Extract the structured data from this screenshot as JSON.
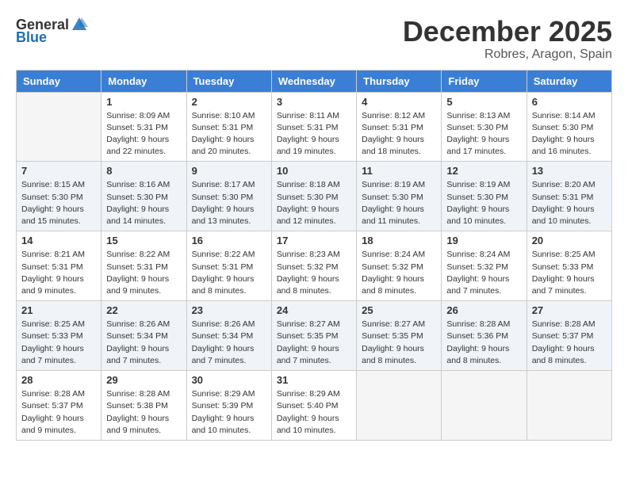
{
  "logo": {
    "general": "General",
    "blue": "Blue"
  },
  "title": "December 2025",
  "location": "Robres, Aragon, Spain",
  "days_of_week": [
    "Sunday",
    "Monday",
    "Tuesday",
    "Wednesday",
    "Thursday",
    "Friday",
    "Saturday"
  ],
  "weeks": [
    [
      {
        "day": "",
        "sunrise": "",
        "sunset": "",
        "daylight": ""
      },
      {
        "day": "1",
        "sunrise": "Sunrise: 8:09 AM",
        "sunset": "Sunset: 5:31 PM",
        "daylight": "Daylight: 9 hours and 22 minutes."
      },
      {
        "day": "2",
        "sunrise": "Sunrise: 8:10 AM",
        "sunset": "Sunset: 5:31 PM",
        "daylight": "Daylight: 9 hours and 20 minutes."
      },
      {
        "day": "3",
        "sunrise": "Sunrise: 8:11 AM",
        "sunset": "Sunset: 5:31 PM",
        "daylight": "Daylight: 9 hours and 19 minutes."
      },
      {
        "day": "4",
        "sunrise": "Sunrise: 8:12 AM",
        "sunset": "Sunset: 5:31 PM",
        "daylight": "Daylight: 9 hours and 18 minutes."
      },
      {
        "day": "5",
        "sunrise": "Sunrise: 8:13 AM",
        "sunset": "Sunset: 5:30 PM",
        "daylight": "Daylight: 9 hours and 17 minutes."
      },
      {
        "day": "6",
        "sunrise": "Sunrise: 8:14 AM",
        "sunset": "Sunset: 5:30 PM",
        "daylight": "Daylight: 9 hours and 16 minutes."
      }
    ],
    [
      {
        "day": "7",
        "sunrise": "Sunrise: 8:15 AM",
        "sunset": "Sunset: 5:30 PM",
        "daylight": "Daylight: 9 hours and 15 minutes."
      },
      {
        "day": "8",
        "sunrise": "Sunrise: 8:16 AM",
        "sunset": "Sunset: 5:30 PM",
        "daylight": "Daylight: 9 hours and 14 minutes."
      },
      {
        "day": "9",
        "sunrise": "Sunrise: 8:17 AM",
        "sunset": "Sunset: 5:30 PM",
        "daylight": "Daylight: 9 hours and 13 minutes."
      },
      {
        "day": "10",
        "sunrise": "Sunrise: 8:18 AM",
        "sunset": "Sunset: 5:30 PM",
        "daylight": "Daylight: 9 hours and 12 minutes."
      },
      {
        "day": "11",
        "sunrise": "Sunrise: 8:19 AM",
        "sunset": "Sunset: 5:30 PM",
        "daylight": "Daylight: 9 hours and 11 minutes."
      },
      {
        "day": "12",
        "sunrise": "Sunrise: 8:19 AM",
        "sunset": "Sunset: 5:30 PM",
        "daylight": "Daylight: 9 hours and 10 minutes."
      },
      {
        "day": "13",
        "sunrise": "Sunrise: 8:20 AM",
        "sunset": "Sunset: 5:31 PM",
        "daylight": "Daylight: 9 hours and 10 minutes."
      }
    ],
    [
      {
        "day": "14",
        "sunrise": "Sunrise: 8:21 AM",
        "sunset": "Sunset: 5:31 PM",
        "daylight": "Daylight: 9 hours and 9 minutes."
      },
      {
        "day": "15",
        "sunrise": "Sunrise: 8:22 AM",
        "sunset": "Sunset: 5:31 PM",
        "daylight": "Daylight: 9 hours and 9 minutes."
      },
      {
        "day": "16",
        "sunrise": "Sunrise: 8:22 AM",
        "sunset": "Sunset: 5:31 PM",
        "daylight": "Daylight: 9 hours and 8 minutes."
      },
      {
        "day": "17",
        "sunrise": "Sunrise: 8:23 AM",
        "sunset": "Sunset: 5:32 PM",
        "daylight": "Daylight: 9 hours and 8 minutes."
      },
      {
        "day": "18",
        "sunrise": "Sunrise: 8:24 AM",
        "sunset": "Sunset: 5:32 PM",
        "daylight": "Daylight: 9 hours and 8 minutes."
      },
      {
        "day": "19",
        "sunrise": "Sunrise: 8:24 AM",
        "sunset": "Sunset: 5:32 PM",
        "daylight": "Daylight: 9 hours and 7 minutes."
      },
      {
        "day": "20",
        "sunrise": "Sunrise: 8:25 AM",
        "sunset": "Sunset: 5:33 PM",
        "daylight": "Daylight: 9 hours and 7 minutes."
      }
    ],
    [
      {
        "day": "21",
        "sunrise": "Sunrise: 8:25 AM",
        "sunset": "Sunset: 5:33 PM",
        "daylight": "Daylight: 9 hours and 7 minutes."
      },
      {
        "day": "22",
        "sunrise": "Sunrise: 8:26 AM",
        "sunset": "Sunset: 5:34 PM",
        "daylight": "Daylight: 9 hours and 7 minutes."
      },
      {
        "day": "23",
        "sunrise": "Sunrise: 8:26 AM",
        "sunset": "Sunset: 5:34 PM",
        "daylight": "Daylight: 9 hours and 7 minutes."
      },
      {
        "day": "24",
        "sunrise": "Sunrise: 8:27 AM",
        "sunset": "Sunset: 5:35 PM",
        "daylight": "Daylight: 9 hours and 7 minutes."
      },
      {
        "day": "25",
        "sunrise": "Sunrise: 8:27 AM",
        "sunset": "Sunset: 5:35 PM",
        "daylight": "Daylight: 9 hours and 8 minutes."
      },
      {
        "day": "26",
        "sunrise": "Sunrise: 8:28 AM",
        "sunset": "Sunset: 5:36 PM",
        "daylight": "Daylight: 9 hours and 8 minutes."
      },
      {
        "day": "27",
        "sunrise": "Sunrise: 8:28 AM",
        "sunset": "Sunset: 5:37 PM",
        "daylight": "Daylight: 9 hours and 8 minutes."
      }
    ],
    [
      {
        "day": "28",
        "sunrise": "Sunrise: 8:28 AM",
        "sunset": "Sunset: 5:37 PM",
        "daylight": "Daylight: 9 hours and 9 minutes."
      },
      {
        "day": "29",
        "sunrise": "Sunrise: 8:28 AM",
        "sunset": "Sunset: 5:38 PM",
        "daylight": "Daylight: 9 hours and 9 minutes."
      },
      {
        "day": "30",
        "sunrise": "Sunrise: 8:29 AM",
        "sunset": "Sunset: 5:39 PM",
        "daylight": "Daylight: 9 hours and 10 minutes."
      },
      {
        "day": "31",
        "sunrise": "Sunrise: 8:29 AM",
        "sunset": "Sunset: 5:40 PM",
        "daylight": "Daylight: 9 hours and 10 minutes."
      },
      {
        "day": "",
        "sunrise": "",
        "sunset": "",
        "daylight": ""
      },
      {
        "day": "",
        "sunrise": "",
        "sunset": "",
        "daylight": ""
      },
      {
        "day": "",
        "sunrise": "",
        "sunset": "",
        "daylight": ""
      }
    ]
  ]
}
